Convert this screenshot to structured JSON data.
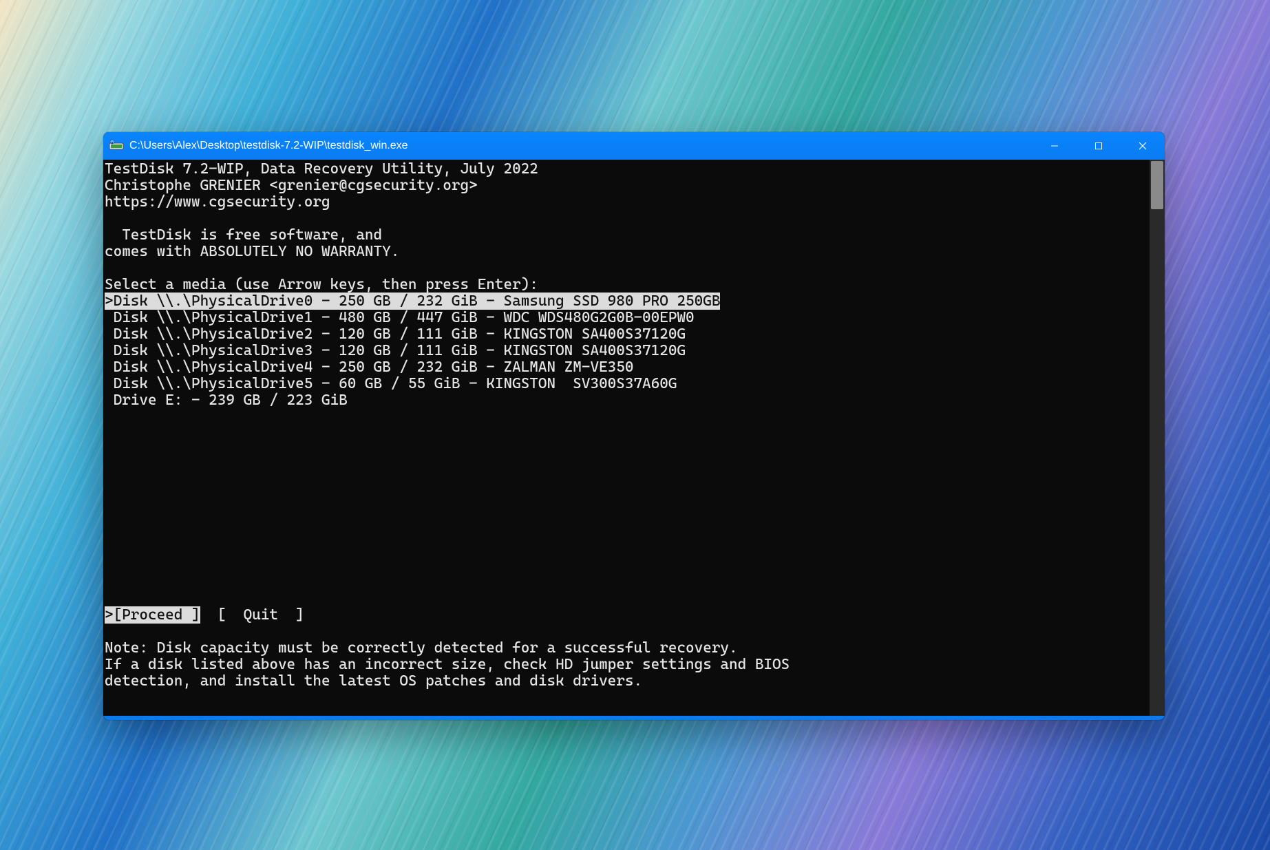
{
  "window": {
    "title": "C:\\Users\\Alex\\Desktop\\testdisk-7.2-WIP\\testdisk_win.exe"
  },
  "header": {
    "line1": "TestDisk 7.2-WIP, Data Recovery Utility, July 2022",
    "line2": "Christophe GRENIER <grenier@cgsecurity.org>",
    "line3": "https://www.cgsecurity.org"
  },
  "license": {
    "line1": "  TestDisk is free software, and",
    "line2": "comes with ABSOLUTELY NO WARRANTY."
  },
  "prompt": "Select a media (use Arrow keys, then press Enter):",
  "drives": [
    {
      "text": "Disk \\\\.\\PhysicalDrive0 - 250 GB / 232 GiB - Samsung SSD 980 PRO 250GB",
      "selected": true
    },
    {
      "text": "Disk \\\\.\\PhysicalDrive1 - 480 GB / 447 GiB - WDC WDS480G2G0B-00EPW0",
      "selected": false
    },
    {
      "text": "Disk \\\\.\\PhysicalDrive2 - 120 GB / 111 GiB - KINGSTON SA400S37120G",
      "selected": false
    },
    {
      "text": "Disk \\\\.\\PhysicalDrive3 - 120 GB / 111 GiB - KINGSTON SA400S37120G",
      "selected": false
    },
    {
      "text": "Disk \\\\.\\PhysicalDrive4 - 250 GB / 232 GiB - ZALMAN ZM-VE350",
      "selected": false
    },
    {
      "text": "Disk \\\\.\\PhysicalDrive5 - 60 GB / 55 GiB - KINGSTON  SV300S37A60G",
      "selected": false
    },
    {
      "text": "Drive E: - 239 GB / 223 GiB",
      "selected": false
    }
  ],
  "menu": {
    "selected_marker": ">",
    "proceed": "[Proceed ]",
    "quit": "[  Quit  ]"
  },
  "note": {
    "line1": "Note: Disk capacity must be correctly detected for a successful recovery.",
    "line2": "If a disk listed above has an incorrect size, check HD jumper settings and BIOS",
    "line3": "detection, and install the latest OS patches and disk drivers."
  }
}
